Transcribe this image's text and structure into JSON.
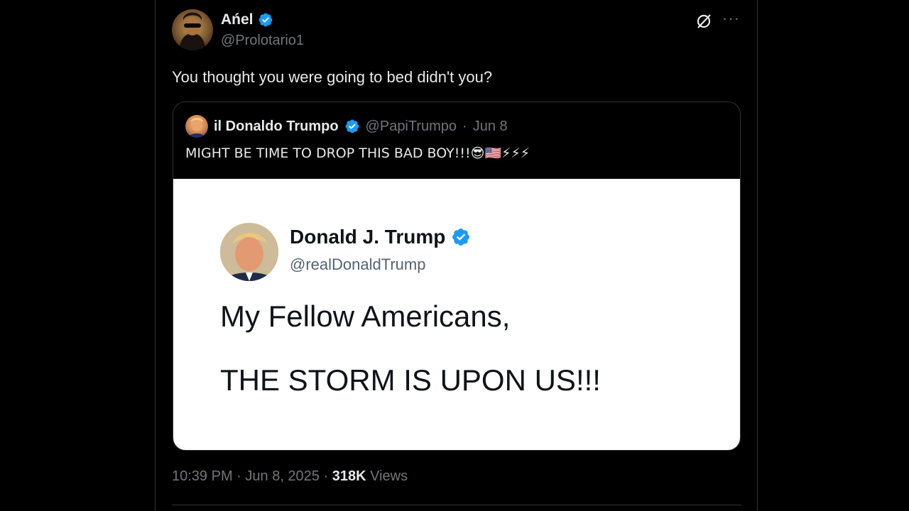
{
  "tweet": {
    "author_name": "Ańel",
    "author_handle": "@Prolotario1",
    "text": "You thought you were going to bed didn't you?",
    "time": "10:39 PM",
    "date": "Jun 8, 2025",
    "views_count": "318K",
    "views_label": "Views"
  },
  "quote": {
    "author_name": "il Donaldo Trumpo",
    "author_handle": "@PapiTrumpo",
    "date": "Jun 8",
    "text": "MIGHT BE TIME TO DROP THIS BAD BOY!!!😎🇺🇸⚡⚡⚡"
  },
  "media": {
    "name": "Donald J. Trump",
    "handle": "@realDonaldTrump",
    "line1": "My Fellow Americans,",
    "line2": "THE STORM IS UPON US!!!"
  },
  "icons": {
    "verified": "verified-badge-icon",
    "grok": "grok-icon",
    "more": "more-icon"
  },
  "colors": {
    "verified_blue": "#1d9bf0",
    "muted": "#71767b"
  }
}
